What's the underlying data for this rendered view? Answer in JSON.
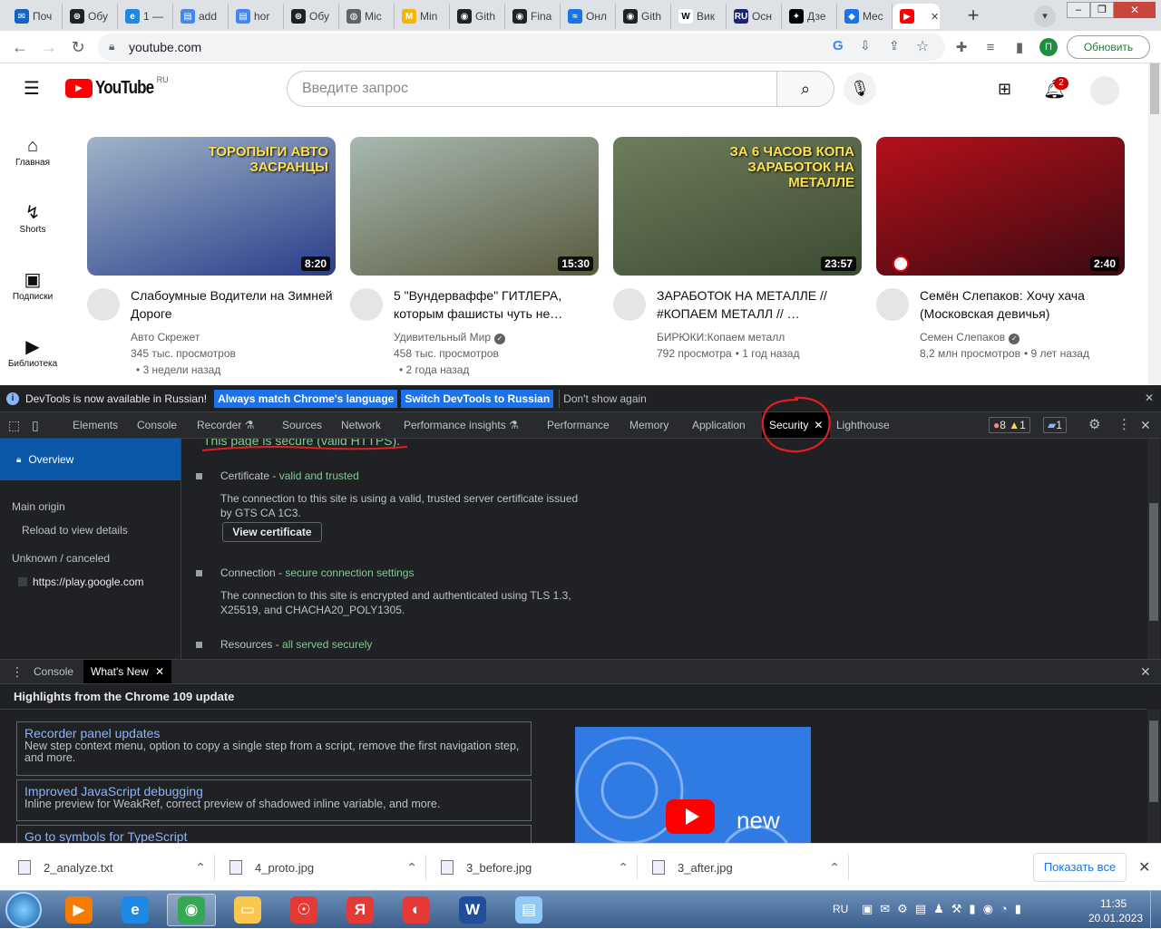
{
  "tabs": [
    {
      "label": "Поч",
      "icon": "mail-icon",
      "color": "#1565c0",
      "glyph": "✉"
    },
    {
      "label": "Обу",
      "icon": "openai-icon",
      "color": "#202124",
      "glyph": "⊛"
    },
    {
      "label": "1 —",
      "icon": "edge-icon",
      "color": "#1e88e5",
      "glyph": "e"
    },
    {
      "label": "add",
      "icon": "docs-icon",
      "color": "#4285f4",
      "glyph": "▤"
    },
    {
      "label": "hor",
      "icon": "docs-icon",
      "color": "#4285f4",
      "glyph": "▤"
    },
    {
      "label": "Обу",
      "icon": "openai-icon",
      "color": "#202124",
      "glyph": "⊛"
    },
    {
      "label": "Mic",
      "icon": "globe-icon",
      "color": "#5f6368",
      "glyph": "◍"
    },
    {
      "label": "Min",
      "icon": "miro-icon",
      "color": "#f7b500",
      "glyph": "M"
    },
    {
      "label": "Gith",
      "icon": "github-icon",
      "color": "#202124",
      "glyph": "◉"
    },
    {
      "label": "Fina",
      "icon": "github-icon",
      "color": "#202124",
      "glyph": "◉"
    },
    {
      "label": "Онл",
      "icon": "chart-icon",
      "color": "#1a73e8",
      "glyph": "≈"
    },
    {
      "label": "Gith",
      "icon": "github-icon",
      "color": "#202124",
      "glyph": "◉"
    },
    {
      "label": "Вик",
      "icon": "wikipedia-icon",
      "color": "#ffffff",
      "glyph": "W"
    },
    {
      "label": "Осн",
      "icon": "ru-icon",
      "color": "#1a237e",
      "glyph": "RU"
    },
    {
      "label": "Дзе",
      "icon": "dzen-icon",
      "color": "#000000",
      "glyph": "✦"
    },
    {
      "label": "Mec",
      "icon": "messenger-icon",
      "color": "#1a73e8",
      "glyph": "◆"
    },
    {
      "label": "",
      "icon": "youtube-icon",
      "color": "#ff0000",
      "glyph": "▶"
    }
  ],
  "address": {
    "url": "youtube.com",
    "update_label": "Обновить",
    "profile_letter": "П"
  },
  "youtube": {
    "logo_text": "YouTube",
    "logo_region": "RU",
    "search_placeholder": "Введите запрос",
    "notification_count": "2",
    "sidebar": [
      {
        "label": "Главная",
        "icon": "home-icon",
        "glyph": "⌂"
      },
      {
        "label": "Shorts",
        "icon": "shorts-icon",
        "glyph": "↯"
      },
      {
        "label": "Подписки",
        "icon": "subscriptions-icon",
        "glyph": "▣"
      },
      {
        "label": "Библиотека",
        "icon": "library-icon",
        "glyph": "▶"
      }
    ],
    "videos": [
      {
        "title": "Слабоумные Водители на Зимней Дороге",
        "channel": "Авто Скрежет",
        "verified": false,
        "views": "345 тыс. просмотров",
        "age": "• 3 недели назад",
        "duration": "8:20",
        "overlay": "ТОРОПЫГИ АВТО ЗАСРАНЦЫ",
        "color1": "#9fb4c8",
        "color2": "#2a3d8a"
      },
      {
        "title": "5 \"Вундерваффе\" ГИТЛЕРА, которым фашисты чуть не…",
        "channel": "Удивительный Мир",
        "verified": true,
        "views": "458 тыс. просмотров",
        "age": "• 2 года назад",
        "duration": "15:30",
        "overlay": "",
        "color1": "#a7b9b0",
        "color2": "#5a5a3e"
      },
      {
        "title": "ЗАРАБОТОК НА МЕТАЛЛЕ // #КОПАЕМ МЕТАЛЛ // …",
        "channel": "БИРЮКИ:Копаем металл",
        "verified": false,
        "views": "792 просмотра",
        "age": "• 1 год назад",
        "duration": "23:57",
        "overlay": "ЗА 6 ЧАСОВ КОПА ЗАРАБОТОК НА МЕТАЛЛЕ",
        "color1": "#6d7d5c",
        "color2": "#3d4a33"
      },
      {
        "title": "Семён Слепаков: Хочу хача (Московская девичья)",
        "channel": "Семен Слепаков",
        "verified": true,
        "views": "8,2 млн просмотров",
        "age": "• 9 лет назад",
        "duration": "2:40",
        "overlay": "",
        "color1": "#b5101a",
        "color2": "#3a0a12"
      }
    ]
  },
  "devtools": {
    "infobar": {
      "message": "DevTools is now available in Russian!",
      "btn_match": "Always match Chrome's language",
      "btn_switch": "Switch DevTools to Russian",
      "btn_dismiss": "Don't show again"
    },
    "tabs": [
      "Elements",
      "Console",
      "Recorder ⚗",
      "Sources",
      "Network",
      "Performance insights ⚗",
      "Performance",
      "Memory",
      "Application",
      "Security",
      "Lighthouse"
    ],
    "active_tab": "Security",
    "errors": "8",
    "warnings": "1",
    "messages": "1",
    "security": {
      "overview_label": "Overview",
      "main_origin_label": "Main origin",
      "reload_label": "Reload to view details",
      "unknown_label": "Unknown / canceled",
      "origin_url": "https://play.google.com",
      "summary": "This page is secure (valid HTTPS).",
      "certificate_title": "Certificate - ",
      "certificate_status": "valid and trusted",
      "certificate_desc": "The connection to this site is using a valid, trusted server certificate issued by GTS CA 1C3.",
      "view_certificate": "View certificate",
      "connection_title": "Connection - ",
      "connection_status": "secure connection settings",
      "connection_desc": "The connection to this site is encrypted and authenticated using TLS 1.3, X25519, and CHACHA20_POLY1305.",
      "resources_title": "Resources - ",
      "resources_status": "all served securely"
    },
    "drawer": {
      "tab_console": "Console",
      "tab_whatsnew": "What's New",
      "heading": "Highlights from the Chrome 109 update",
      "features": [
        {
          "title": "Recorder panel updates",
          "desc": "New step context menu, option to copy a single step from a script, remove the first navigation step, and more."
        },
        {
          "title": "Improved JavaScript debugging",
          "desc": "Inline preview for WeakRef, correct preview of shadowed inline variable, and more."
        },
        {
          "title": "Go to symbols for TypeScript",
          "desc": ""
        }
      ],
      "promo_text": "new"
    }
  },
  "downloads": {
    "files": [
      "2_analyze.txt",
      "4_proto.jpg",
      "3_before.jpg",
      "3_after.jpg"
    ],
    "show_all": "Показать все"
  },
  "taskbar": {
    "lang": "RU",
    "time": "11:35",
    "date": "20.01.2023",
    "apps": [
      {
        "icon": "media-player-icon",
        "glyph": "▶",
        "color": "#f57c00"
      },
      {
        "icon": "internet-explorer-icon",
        "glyph": "e",
        "color": "#1e88e5"
      },
      {
        "icon": "chrome-icon",
        "glyph": "◉",
        "color": "#34a853"
      },
      {
        "icon": "file-explorer-icon",
        "glyph": "▭",
        "color": "#f9c74f"
      },
      {
        "icon": "yandex-disk-icon",
        "glyph": "☉",
        "color": "#e53935"
      },
      {
        "icon": "yandex-browser-icon",
        "glyph": "Я",
        "color": "#e53935"
      },
      {
        "icon": "ccleaner-icon",
        "glyph": "◐",
        "color": "#e53935"
      },
      {
        "icon": "word-icon",
        "glyph": "W",
        "color": "#1e4e9c"
      },
      {
        "icon": "notepad-icon",
        "glyph": "▤",
        "color": "#90caf9"
      }
    ]
  }
}
